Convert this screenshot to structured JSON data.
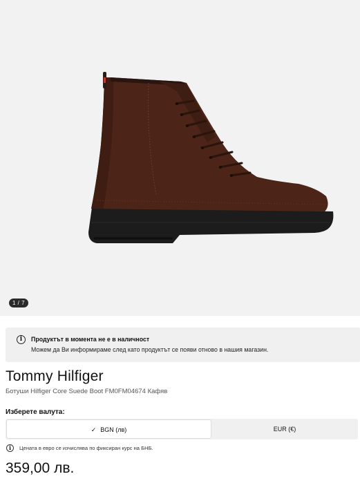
{
  "gallery": {
    "image_name": "brown suede lace-up boot",
    "counter": "1 / 7"
  },
  "notice": {
    "icon": "info-icon",
    "title": "Продуктът в момента не е в наличност",
    "text": "Можем да Ви информираме след като продуктът се появи отново в нашия магазин."
  },
  "product": {
    "brand": "Tommy Hilfiger",
    "name": "Ботуши Hilfiger Core Suede Boot FM0FM04674 Кафяв"
  },
  "currency": {
    "label": "Изберете валута:",
    "options": [
      {
        "label": "BGN (лв)",
        "selected": true,
        "icon": "check-icon"
      },
      {
        "label": "EUR (€)",
        "selected": false
      }
    ],
    "note_icon": "info-icon",
    "note": "Цената в евро се изчислява по фиксиран курс на БНБ."
  },
  "price": "359,00 лв."
}
